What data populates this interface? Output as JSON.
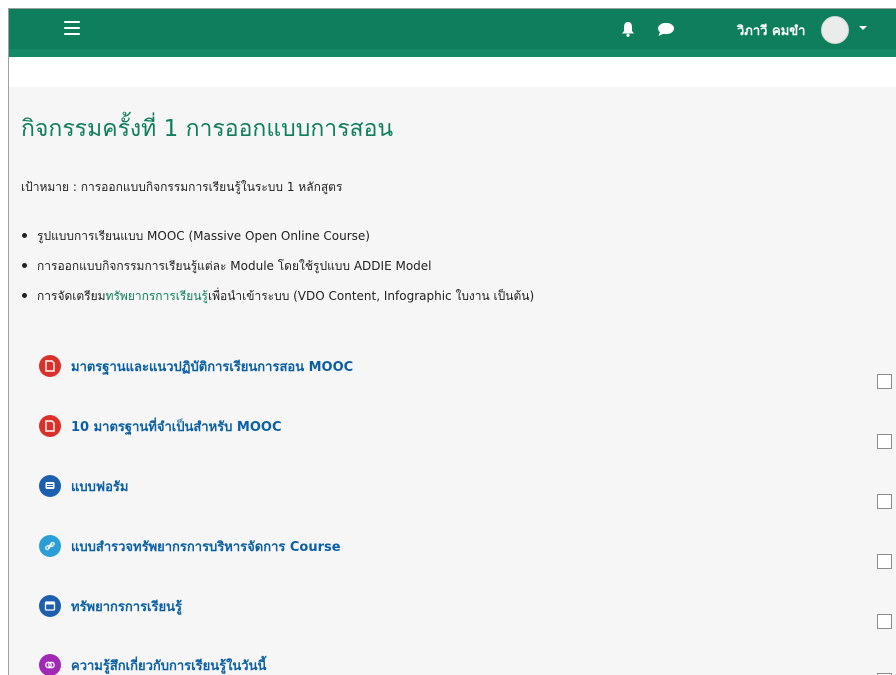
{
  "header": {
    "user_name": "วิภาวี คมขำ",
    "bar_color": "#0f7e5d",
    "icons": [
      "menu-icon",
      "bell-icon",
      "chat-icon",
      "avatar",
      "chevron-down-icon"
    ]
  },
  "page": {
    "title": "กิจกรรมครั้งที่ 1 การออกแบบการสอน",
    "goal": "เป้าหมาย : การออกแบบกิจกรรมการเรียนรู้ในระบบ 1 หลักสูตร",
    "bullets": [
      "รูปแบบการเรียนแบบ MOOC (Massive Open Online Course)",
      "การออกแบบกิจกรรมการเรียนรู้แต่ละ Module โดยใช้รูปแบบ ADDIE Model"
    ],
    "bullet3": {
      "before": "การจัดเตรียม",
      "link": "ทรัพยากรการเรียนรู้",
      "after": "เพื่อนำเข้าระบบ (VDO Content, Infographic ใบงาน เป็นต้น)"
    }
  },
  "activities": [
    {
      "label": "มาตรฐานและแนวปฏิบัติการเรียนการสอน MOOC",
      "icon": "pdf-icon",
      "color": "#d9302a"
    },
    {
      "label": "10 มาตรฐานที่จำเป็นสำหรับ MOOC",
      "icon": "pdf-icon",
      "color": "#d9302a"
    },
    {
      "label": "แบบฟอรัม",
      "icon": "forum-icon",
      "color": "#1d5fae"
    },
    {
      "label": "แบบสำรวจทรัพยากรการบริหารจัดการ Course",
      "icon": "link-icon",
      "color": "#2b9ed8"
    },
    {
      "label": "ทรัพยากรการเรียนรู้",
      "icon": "page-icon",
      "color": "#1d5fae"
    },
    {
      "label": "ความรู้สึกเกี่ยวกับการเรียนรู้ในวันนี้",
      "icon": "feedback-icon",
      "color": "#a12ab5"
    }
  ]
}
